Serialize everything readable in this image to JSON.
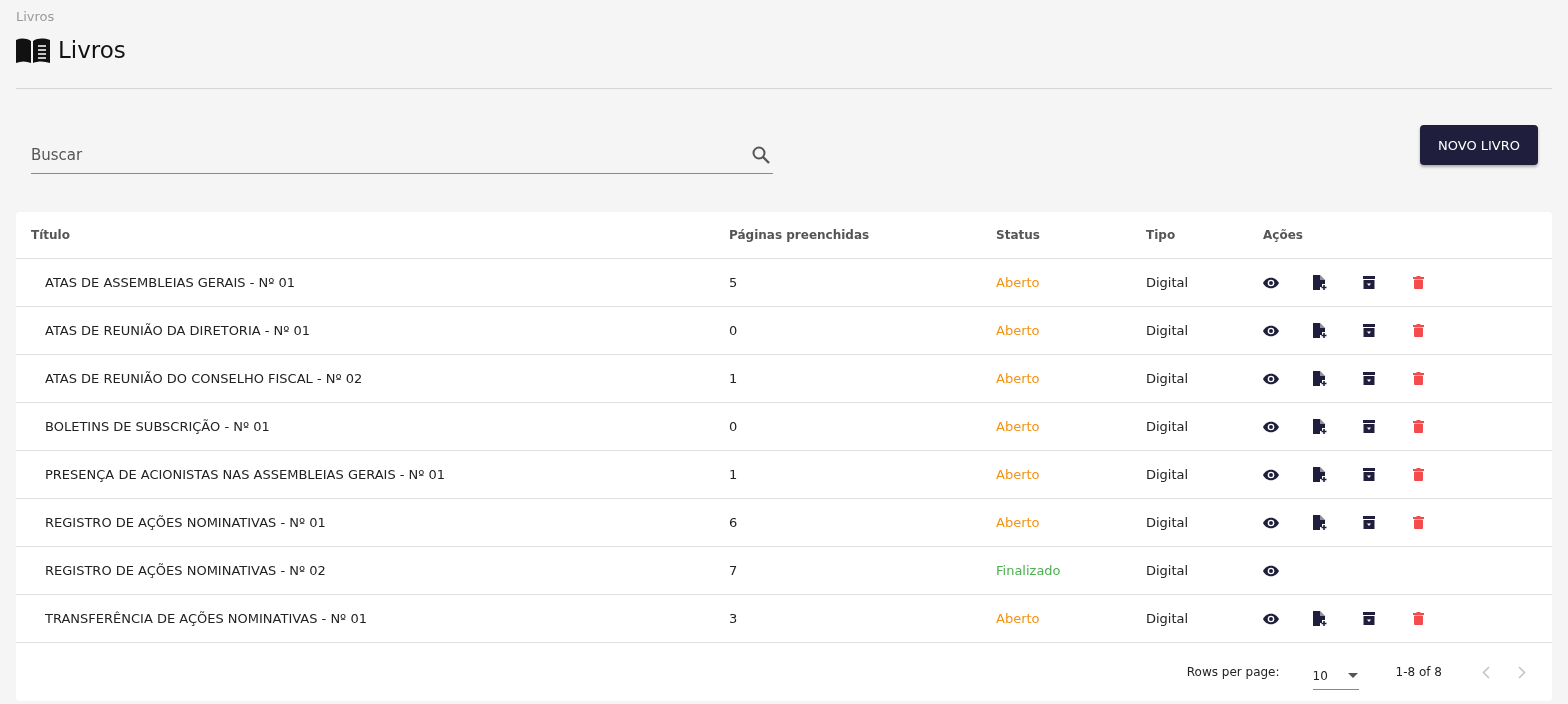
{
  "breadcrumb": "Livros",
  "page_title": "Livros",
  "search": {
    "placeholder": "Buscar"
  },
  "new_button": "NOVO LIVRO",
  "table": {
    "columns": [
      "Título",
      "Páginas preenchidas",
      "Status",
      "Tipo",
      "Ações"
    ],
    "rows": [
      {
        "title": "ATAS DE ASSEMBLEIAS GERAIS - Nº 01",
        "pages": "5",
        "status": {
          "label": "Aberto",
          "color": "#f29312"
        },
        "type": "Digital",
        "actions": [
          {
            "kind": "view"
          },
          {
            "kind": "add-page"
          },
          {
            "kind": "archive"
          },
          {
            "kind": "delete"
          }
        ]
      },
      {
        "title": "ATAS DE REUNIÃO DA DIRETORIA - Nº 01",
        "pages": "0",
        "status": {
          "label": "Aberto",
          "color": "#f29312"
        },
        "type": "Digital",
        "actions": [
          {
            "kind": "view"
          },
          {
            "kind": "add-page"
          },
          {
            "kind": "archive"
          },
          {
            "kind": "delete"
          }
        ]
      },
      {
        "title": "ATAS DE REUNIÃO DO CONSELHO FISCAL - Nº 02",
        "pages": "1",
        "status": {
          "label": "Aberto",
          "color": "#f29312"
        },
        "type": "Digital",
        "actions": [
          {
            "kind": "view"
          },
          {
            "kind": "add-page"
          },
          {
            "kind": "archive"
          },
          {
            "kind": "delete"
          }
        ]
      },
      {
        "title": "BOLETINS DE SUBSCRIÇÃO - Nº 01",
        "pages": "0",
        "status": {
          "label": "Aberto",
          "color": "#f29312"
        },
        "type": "Digital",
        "actions": [
          {
            "kind": "view"
          },
          {
            "kind": "add-page"
          },
          {
            "kind": "archive"
          },
          {
            "kind": "delete"
          }
        ]
      },
      {
        "title": "PRESENÇA DE ACIONISTAS NAS ASSEMBLEIAS GERAIS - Nº 01",
        "pages": "1",
        "status": {
          "label": "Aberto",
          "color": "#f29312"
        },
        "type": "Digital",
        "actions": [
          {
            "kind": "view"
          },
          {
            "kind": "add-page"
          },
          {
            "kind": "archive"
          },
          {
            "kind": "delete"
          }
        ]
      },
      {
        "title": "REGISTRO DE AÇÕES NOMINATIVAS - Nº 01",
        "pages": "6",
        "status": {
          "label": "Aberto",
          "color": "#f29312"
        },
        "type": "Digital",
        "actions": [
          {
            "kind": "view"
          },
          {
            "kind": "add-page"
          },
          {
            "kind": "archive"
          },
          {
            "kind": "delete"
          }
        ]
      },
      {
        "title": "REGISTRO DE AÇÕES NOMINATIVAS - Nº 02",
        "pages": "7",
        "status": {
          "label": "Finalizado",
          "color": "#4caf50"
        },
        "type": "Digital",
        "actions": [
          {
            "kind": "view"
          }
        ]
      },
      {
        "title": "TRANSFERÊNCIA DE AÇÕES NOMINATIVAS - Nº 01",
        "pages": "3",
        "status": {
          "label": "Aberto",
          "color": "#f29312"
        },
        "type": "Digital",
        "actions": [
          {
            "kind": "view"
          },
          {
            "kind": "add-page"
          },
          {
            "kind": "archive"
          },
          {
            "kind": "delete"
          }
        ]
      }
    ]
  },
  "pagination": {
    "rows_per_page_label": "Rows per page:",
    "rows_per_page": "10",
    "range": "1-8 of 8"
  }
}
